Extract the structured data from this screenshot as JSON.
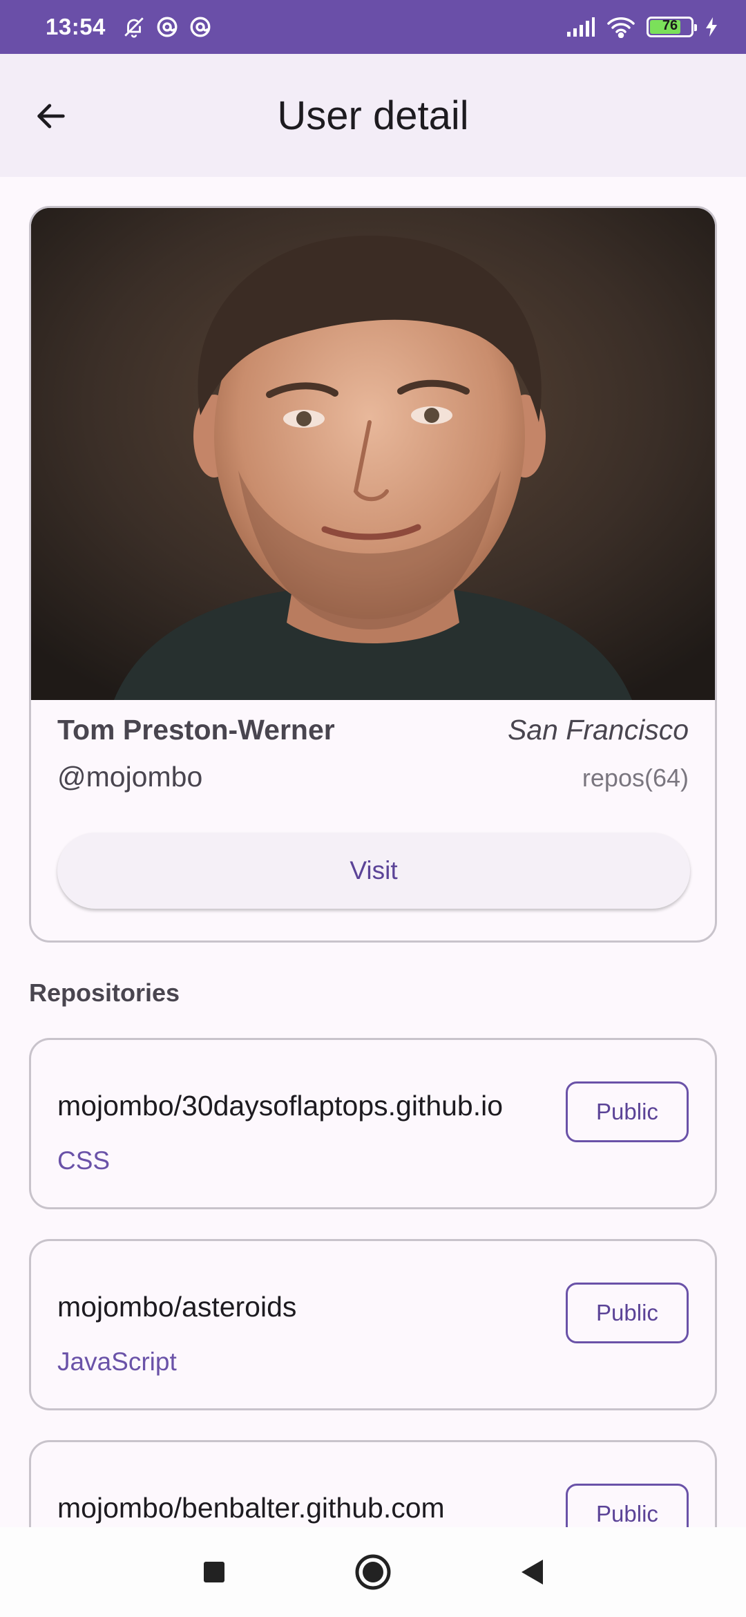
{
  "status_bar": {
    "time": "13:54",
    "battery_level": "76",
    "icons": [
      "bell-off-icon",
      "at-sign-icon",
      "at-sign-icon",
      "signal-icon",
      "wifi-icon",
      "battery-icon",
      "charging-icon"
    ]
  },
  "app_bar": {
    "title": "User detail",
    "back_icon": "arrow-left-icon"
  },
  "profile": {
    "name": "Tom Preston-Werner",
    "location": "San Francisco",
    "login": "@mojombo",
    "repos_label": "repos(64)",
    "visit_label": "Visit"
  },
  "repositories": {
    "section_title": "Repositories",
    "items": [
      {
        "name": "mojombo/30daysoflaptops.github.io",
        "language": "CSS",
        "visibility": "Public"
      },
      {
        "name": "mojombo/asteroids",
        "language": "JavaScript",
        "visibility": "Public"
      },
      {
        "name": "mojombo/benbalter.github.com",
        "language": "",
        "visibility": "Public"
      }
    ]
  },
  "nav_bar": {
    "items": [
      "recents-square-icon",
      "home-circle-icon",
      "back-triangle-icon"
    ]
  },
  "colors": {
    "status_bar": "#6a4fa8",
    "app_bar": "#f3edf7",
    "accent": "#6a52a8",
    "background": "#fdf8fd"
  }
}
